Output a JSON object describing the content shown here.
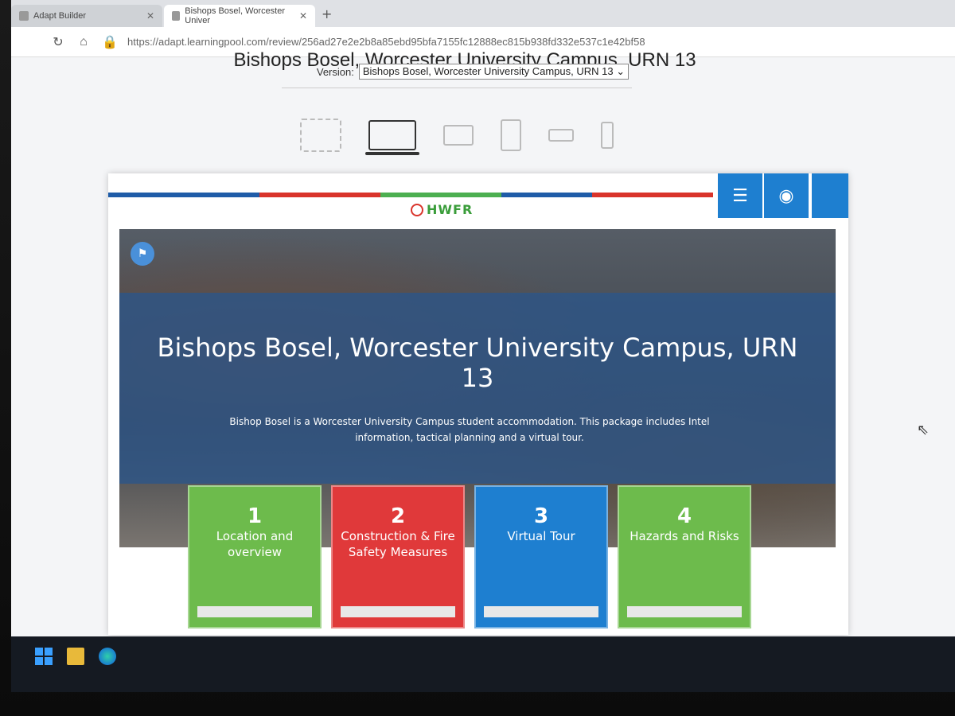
{
  "browser": {
    "tabs": [
      {
        "label": "Adapt Builder",
        "active": false
      },
      {
        "label": "Bishops Bosel, Worcester Univer",
        "active": true
      }
    ],
    "url": "https://adapt.learningpool.com/review/256ad27e2e2b8a85ebd95bfa7155fc12888ec815b938fd332e537c1e42bf58"
  },
  "preview": {
    "title": "Bishops Bosel, Worcester University Campus, URN 13",
    "version_label": "Version:",
    "version_selected": "Bishops Bosel, Worcester University Campus, URN 13"
  },
  "course": {
    "logo_text": "HWFR",
    "hero_title": "Bishops Bosel, Worcester University Campus, URN 13",
    "hero_description": "Bishop Bosel is a Worcester University Campus student accommodation. This package includes Intel information, tactical planning and a virtual tour.",
    "tiles": [
      {
        "number": "1",
        "label": "Location and overview",
        "color": "#6dbb4c"
      },
      {
        "number": "2",
        "label": "Construction & Fire Safety Measures",
        "color": "#e0393a"
      },
      {
        "number": "3",
        "label": "Virtual Tour",
        "color": "#1e7fd0"
      },
      {
        "number": "4",
        "label": "Hazards and Risks",
        "color": "#6dbb4c"
      }
    ]
  },
  "icons": {
    "menu": "menu-list-icon",
    "eye": "eye-icon",
    "flag": "flag-icon"
  }
}
